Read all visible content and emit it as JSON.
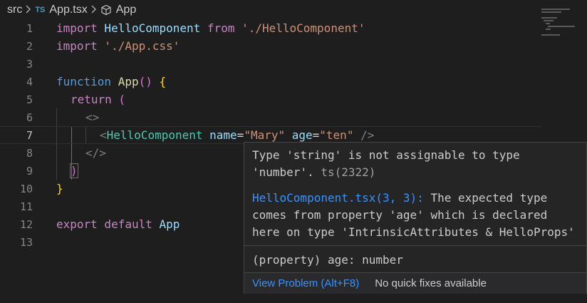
{
  "breadcrumb": {
    "folder": "src",
    "file_badge": "TS",
    "file": "App.tsx",
    "symbol": "App"
  },
  "editor": {
    "line_numbers": [
      "1",
      "2",
      "3",
      "4",
      "5",
      "6",
      "7",
      "8",
      "9",
      "10",
      "11",
      "12",
      "13"
    ],
    "current_line": "7",
    "lines": {
      "l1": {
        "kw": "import",
        "name": " HelloComponent ",
        "from": "from",
        "str": " './HelloComponent'"
      },
      "l2": {
        "kw": "import",
        "str": " './App.css'"
      },
      "l4": {
        "kw": "function",
        "name": " App",
        "open": "()",
        "brace": " {"
      },
      "l5": {
        "kw": "return",
        "paren": " ("
      },
      "l6": {
        "frag": "<>"
      },
      "l7": {
        "lt": "<",
        "tag": "HelloComponent",
        "attr1": " name",
        "eq1": "=",
        "val1": "\"Mary\"",
        "attr2": " age",
        "eq2": "=",
        "val2": "\"ten\"",
        "close": " />"
      },
      "l8": {
        "frag": "</>"
      },
      "l9": {
        "paren": ")"
      },
      "l10": {
        "brace": "}"
      },
      "l12": {
        "kw": "export",
        "kw2": " default",
        "name": " App"
      }
    }
  },
  "hover": {
    "error_line1": "Type 'string' is not assignable to type",
    "error_line2": "'number'.",
    "error_code": " ts(2322)",
    "related_link": "HelloComponent.tsx(3, 3):",
    "related_line1": " The expected type",
    "related_line2": "comes from property 'age' which is declared",
    "related_line3": "here on type 'IntrinsicAttributes & HelloProps'",
    "property": "(property) age: number",
    "view_problem": "View Problem (Alt+F8)",
    "no_fixes": "No quick fixes available"
  },
  "colors": {
    "background": "#1e1e1e",
    "keyword": "#c586c0",
    "string": "#ce9178",
    "link": "#3794ff",
    "error": "#f14c4c"
  },
  "icons": {
    "chevron": "chevron-right-icon",
    "symbol": "cube-icon"
  }
}
